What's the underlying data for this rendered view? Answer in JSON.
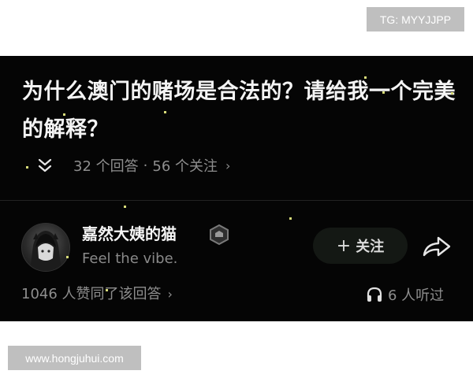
{
  "watermarks": {
    "top": "TG: MYYJJPP",
    "bottom": "www.hongjuhui.com"
  },
  "question": {
    "title": "为什么澳门的赌场是合法的？请给我一个完美的解释？",
    "answers": "32 个回答",
    "separator": "·",
    "followers": "56 个关注",
    "chevron": "›"
  },
  "answer": {
    "author_name": "嘉然大姨的猫",
    "author_bio": "Feel the vibe.",
    "follow_label": "关注",
    "follow_plus": "+",
    "likes_text": "1046 人赞同了该回答",
    "likes_chevron": "›",
    "listened_text": "6 人听过"
  },
  "icons": {
    "collapse": "double-chevron-down-icon",
    "badge": "hexagon-badge-icon",
    "share": "share-arrow-icon",
    "headphones": "headphones-icon"
  },
  "colors": {
    "panel_bg": "#050505",
    "primary_text": "#f4f4f4",
    "secondary_text": "#8e8e8e",
    "sparkle": "#d8dc7a"
  }
}
